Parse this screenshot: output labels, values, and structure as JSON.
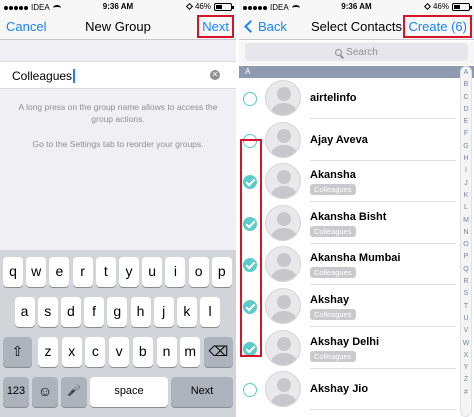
{
  "status_bar": {
    "carrier": "IDEA",
    "time": "9:36 AM",
    "battery": "46%"
  },
  "new_group": {
    "cancel_label": "Cancel",
    "title": "New Group",
    "next_label": "Next",
    "group_name_value": "Colleagues",
    "hint_1": "A long press on the group name allows to access the group actions.",
    "hint_2": "Go to the Settings tab to reorder your groups."
  },
  "keyboard": {
    "row1": [
      "q",
      "w",
      "e",
      "r",
      "t",
      "y",
      "u",
      "i",
      "o",
      "p"
    ],
    "row2": [
      "a",
      "s",
      "d",
      "f",
      "g",
      "h",
      "j",
      "k",
      "l"
    ],
    "row3": [
      "z",
      "x",
      "c",
      "v",
      "b",
      "n",
      "m"
    ],
    "shift_glyph": "⇧",
    "backspace_glyph": "⌫",
    "numbers_label": "123",
    "emoji_glyph": "☺",
    "mic_glyph": "🎤",
    "space_label": "space",
    "return_label": "Next"
  },
  "select_contacts": {
    "back_label": "Back",
    "title": "Select Contacts",
    "create_label": "Create (6)",
    "search_placeholder": "Search",
    "section_letter": "A",
    "contacts": [
      {
        "name": "airtelinfo",
        "checked": false,
        "tag": ""
      },
      {
        "name": "Ajay Aveva",
        "checked": false,
        "tag": ""
      },
      {
        "name": "Akansha",
        "checked": true,
        "tag": "Colleagues"
      },
      {
        "name": "Akansha Bisht",
        "checked": true,
        "tag": "Colleagues"
      },
      {
        "name": "Akansha Mumbai",
        "checked": true,
        "tag": "Colleagues"
      },
      {
        "name": "Akshay",
        "checked": true,
        "tag": "Colleagues"
      },
      {
        "name": "Akshay Delhi",
        "checked": true,
        "tag": "Colleagues"
      },
      {
        "name": "Akshay Jio",
        "checked": false,
        "tag": ""
      }
    ],
    "index_letters": [
      "A",
      "B",
      "C",
      "D",
      "E",
      "F",
      "G",
      "H",
      "I",
      "J",
      "K",
      "L",
      "M",
      "N",
      "O",
      "P",
      "Q",
      "R",
      "S",
      "T",
      "U",
      "V",
      "W",
      "X",
      "Y",
      "Z",
      "#"
    ]
  },
  "colors": {
    "accent": "#1a82fb",
    "check": "#5dcbc8",
    "highlight_box": "#d3142a"
  }
}
